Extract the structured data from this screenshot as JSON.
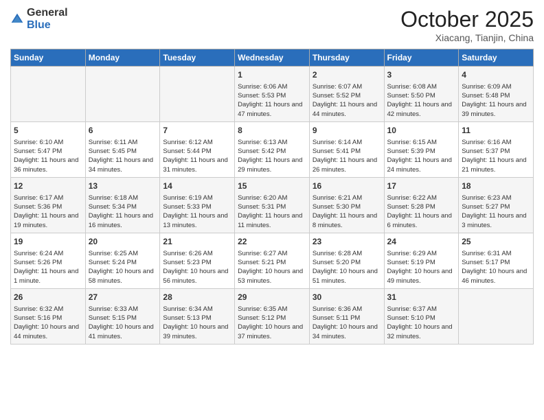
{
  "header": {
    "logo_general": "General",
    "logo_blue": "Blue",
    "month": "October 2025",
    "location": "Xiacang, Tianjin, China"
  },
  "weekdays": [
    "Sunday",
    "Monday",
    "Tuesday",
    "Wednesday",
    "Thursday",
    "Friday",
    "Saturday"
  ],
  "weeks": [
    [
      {
        "day": "",
        "text": ""
      },
      {
        "day": "",
        "text": ""
      },
      {
        "day": "",
        "text": ""
      },
      {
        "day": "1",
        "text": "Sunrise: 6:06 AM\nSunset: 5:53 PM\nDaylight: 11 hours and 47 minutes."
      },
      {
        "day": "2",
        "text": "Sunrise: 6:07 AM\nSunset: 5:52 PM\nDaylight: 11 hours and 44 minutes."
      },
      {
        "day": "3",
        "text": "Sunrise: 6:08 AM\nSunset: 5:50 PM\nDaylight: 11 hours and 42 minutes."
      },
      {
        "day": "4",
        "text": "Sunrise: 6:09 AM\nSunset: 5:48 PM\nDaylight: 11 hours and 39 minutes."
      }
    ],
    [
      {
        "day": "5",
        "text": "Sunrise: 6:10 AM\nSunset: 5:47 PM\nDaylight: 11 hours and 36 minutes."
      },
      {
        "day": "6",
        "text": "Sunrise: 6:11 AM\nSunset: 5:45 PM\nDaylight: 11 hours and 34 minutes."
      },
      {
        "day": "7",
        "text": "Sunrise: 6:12 AM\nSunset: 5:44 PM\nDaylight: 11 hours and 31 minutes."
      },
      {
        "day": "8",
        "text": "Sunrise: 6:13 AM\nSunset: 5:42 PM\nDaylight: 11 hours and 29 minutes."
      },
      {
        "day": "9",
        "text": "Sunrise: 6:14 AM\nSunset: 5:41 PM\nDaylight: 11 hours and 26 minutes."
      },
      {
        "day": "10",
        "text": "Sunrise: 6:15 AM\nSunset: 5:39 PM\nDaylight: 11 hours and 24 minutes."
      },
      {
        "day": "11",
        "text": "Sunrise: 6:16 AM\nSunset: 5:37 PM\nDaylight: 11 hours and 21 minutes."
      }
    ],
    [
      {
        "day": "12",
        "text": "Sunrise: 6:17 AM\nSunset: 5:36 PM\nDaylight: 11 hours and 19 minutes."
      },
      {
        "day": "13",
        "text": "Sunrise: 6:18 AM\nSunset: 5:34 PM\nDaylight: 11 hours and 16 minutes."
      },
      {
        "day": "14",
        "text": "Sunrise: 6:19 AM\nSunset: 5:33 PM\nDaylight: 11 hours and 13 minutes."
      },
      {
        "day": "15",
        "text": "Sunrise: 6:20 AM\nSunset: 5:31 PM\nDaylight: 11 hours and 11 minutes."
      },
      {
        "day": "16",
        "text": "Sunrise: 6:21 AM\nSunset: 5:30 PM\nDaylight: 11 hours and 8 minutes."
      },
      {
        "day": "17",
        "text": "Sunrise: 6:22 AM\nSunset: 5:28 PM\nDaylight: 11 hours and 6 minutes."
      },
      {
        "day": "18",
        "text": "Sunrise: 6:23 AM\nSunset: 5:27 PM\nDaylight: 11 hours and 3 minutes."
      }
    ],
    [
      {
        "day": "19",
        "text": "Sunrise: 6:24 AM\nSunset: 5:26 PM\nDaylight: 11 hours and 1 minute."
      },
      {
        "day": "20",
        "text": "Sunrise: 6:25 AM\nSunset: 5:24 PM\nDaylight: 10 hours and 58 minutes."
      },
      {
        "day": "21",
        "text": "Sunrise: 6:26 AM\nSunset: 5:23 PM\nDaylight: 10 hours and 56 minutes."
      },
      {
        "day": "22",
        "text": "Sunrise: 6:27 AM\nSunset: 5:21 PM\nDaylight: 10 hours and 53 minutes."
      },
      {
        "day": "23",
        "text": "Sunrise: 6:28 AM\nSunset: 5:20 PM\nDaylight: 10 hours and 51 minutes."
      },
      {
        "day": "24",
        "text": "Sunrise: 6:29 AM\nSunset: 5:19 PM\nDaylight: 10 hours and 49 minutes."
      },
      {
        "day": "25",
        "text": "Sunrise: 6:31 AM\nSunset: 5:17 PM\nDaylight: 10 hours and 46 minutes."
      }
    ],
    [
      {
        "day": "26",
        "text": "Sunrise: 6:32 AM\nSunset: 5:16 PM\nDaylight: 10 hours and 44 minutes."
      },
      {
        "day": "27",
        "text": "Sunrise: 6:33 AM\nSunset: 5:15 PM\nDaylight: 10 hours and 41 minutes."
      },
      {
        "day": "28",
        "text": "Sunrise: 6:34 AM\nSunset: 5:13 PM\nDaylight: 10 hours and 39 minutes."
      },
      {
        "day": "29",
        "text": "Sunrise: 6:35 AM\nSunset: 5:12 PM\nDaylight: 10 hours and 37 minutes."
      },
      {
        "day": "30",
        "text": "Sunrise: 6:36 AM\nSunset: 5:11 PM\nDaylight: 10 hours and 34 minutes."
      },
      {
        "day": "31",
        "text": "Sunrise: 6:37 AM\nSunset: 5:10 PM\nDaylight: 10 hours and 32 minutes."
      },
      {
        "day": "",
        "text": ""
      }
    ]
  ]
}
